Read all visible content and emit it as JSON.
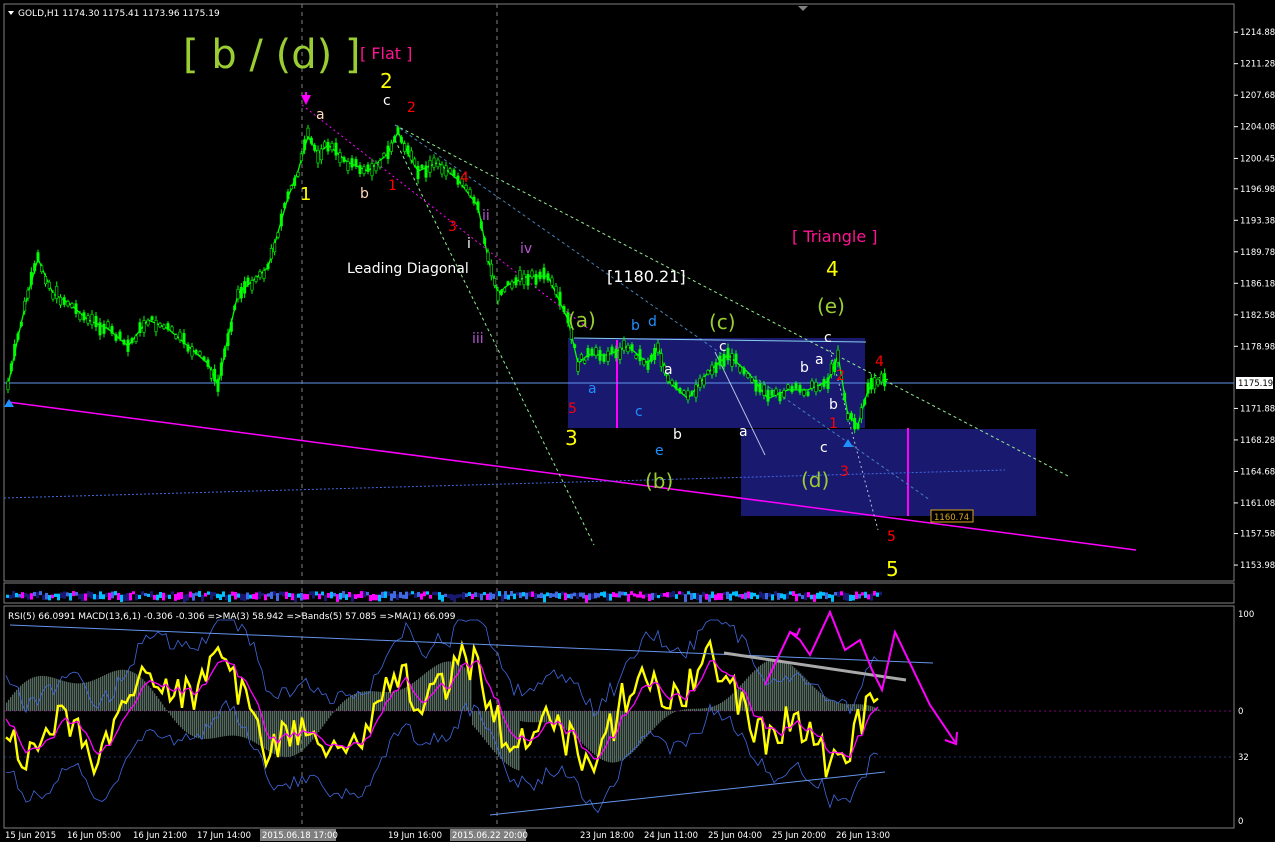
{
  "window": {
    "symbol_header": "GOLD,H1  1174.30 1175.41 1173.96 1175.19",
    "current_price_label": "1175.19",
    "target_label": "1160.74",
    "level_label": "[1180.21]"
  },
  "indicator": {
    "header": "RSI(5) 66.0991  MACD(13,6,1) -0.306 -0.306  =>MA(3) 58.942  =>Bands(5) 57.085  =>MA(1) 66.099",
    "scale_labels": [
      "100",
      "0",
      "32",
      "0"
    ]
  },
  "colors": {
    "background": "#000000",
    "bull_candle": "#00ff00",
    "bear_candle": "#000000",
    "rsi": "#ffff00",
    "ma": "#ff00ff",
    "bands": "#4169e1",
    "box": "#191970",
    "trendline": "#ff00ff",
    "green_text": "#9acd32",
    "yellow_text": "#ffff00",
    "red_text": "#ff0000",
    "cyan_text": "#1e90ff",
    "pink_text": "#ff1493"
  },
  "chart_data": {
    "type": "line",
    "title": "GOLD,H1",
    "y_ticks": [
      "1214.88",
      "1211.28",
      "1207.68",
      "1204.08",
      "1200.45",
      "1196.98",
      "1193.38",
      "1189.78",
      "1186.18",
      "1182.58",
      "1178.98",
      "1175.19",
      "1171.88",
      "1168.28",
      "1164.68",
      "1161.08",
      "1157.58",
      "1153.98"
    ],
    "x_ticks": [
      "15 Jun 2015",
      "16 Jun 05:00",
      "16 Jun 21:00",
      "17 Jun 14:00",
      "2015.06.18 17:00",
      "19 Jun 16:00",
      "2015.06.22 20:00",
      "23 Jun 18:00",
      "24 Jun 11:00",
      "25 Jun 04:00",
      "25 Jun 20:00",
      "26 Jun 13:00"
    ],
    "ylim": [
      1152.5,
      1216.5
    ],
    "close_path": [
      [
        0,
        1174.5
      ],
      [
        10,
        1180
      ],
      [
        20,
        1185
      ],
      [
        30,
        1189
      ],
      [
        45,
        1185
      ],
      [
        60,
        1184
      ],
      [
        80,
        1182
      ],
      [
        100,
        1181
      ],
      [
        120,
        1179
      ],
      [
        140,
        1182
      ],
      [
        160,
        1181
      ],
      [
        180,
        1179
      ],
      [
        200,
        1177
      ],
      [
        210,
        1174.5
      ],
      [
        220,
        1180
      ],
      [
        230,
        1185
      ],
      [
        240,
        1186
      ],
      [
        260,
        1188
      ],
      [
        270,
        1192
      ],
      [
        280,
        1196
      ],
      [
        290,
        1199
      ],
      [
        300,
        1203
      ],
      [
        310,
        1201
      ],
      [
        320,
        1202
      ],
      [
        340,
        1200
      ],
      [
        360,
        1199
      ],
      [
        380,
        1201
      ],
      [
        390,
        1203.5
      ],
      [
        400,
        1201
      ],
      [
        410,
        1199
      ],
      [
        430,
        1200
      ],
      [
        450,
        1198
      ],
      [
        470,
        1195
      ],
      [
        480,
        1189
      ],
      [
        490,
        1185
      ],
      [
        500,
        1186
      ],
      [
        520,
        1187
      ],
      [
        540,
        1187
      ],
      [
        560,
        1182
      ],
      [
        570,
        1177
      ],
      [
        580,
        1178
      ],
      [
        600,
        1178
      ],
      [
        620,
        1179
      ],
      [
        640,
        1177
      ],
      [
        650,
        1179
      ],
      [
        660,
        1175
      ],
      [
        680,
        1173
      ],
      [
        700,
        1176
      ],
      [
        720,
        1178
      ],
      [
        740,
        1176
      ],
      [
        760,
        1173
      ],
      [
        780,
        1174
      ],
      [
        800,
        1174
      ],
      [
        820,
        1175
      ],
      [
        830,
        1178
      ],
      [
        840,
        1171
      ],
      [
        850,
        1170
      ],
      [
        860,
        1174
      ],
      [
        870,
        1175
      ],
      [
        880,
        1175.2
      ]
    ],
    "wave_labels": [
      {
        "text": "[ b / (d) ]",
        "color": "#9acd32",
        "size": 40
      },
      {
        "text": "[ Flat ]",
        "color": "#ff1493",
        "size": 16
      },
      {
        "text": "[ Triangle ]",
        "color": "#ff1493",
        "size": 16
      },
      {
        "text": "Leading Diagonal",
        "color": "#ffffff",
        "size": 14
      },
      {
        "text": "2",
        "color": "#ffff00",
        "size": 20
      },
      {
        "text": "1",
        "color": "#ffff00",
        "size": 18
      },
      {
        "text": "3",
        "color": "#ffff00",
        "size": 20
      },
      {
        "text": "4",
        "color": "#ffff00",
        "size": 20
      },
      {
        "text": "5",
        "color": "#ffff00",
        "size": 20
      },
      {
        "text": "(a)",
        "color": "#9acd32",
        "size": 20
      },
      {
        "text": "(b)",
        "color": "#9acd32",
        "size": 20
      },
      {
        "text": "(c)",
        "color": "#9acd32",
        "size": 20
      },
      {
        "text": "(d)",
        "color": "#9acd32",
        "size": 20
      },
      {
        "text": "(e)",
        "color": "#9acd32",
        "size": 20
      }
    ]
  }
}
